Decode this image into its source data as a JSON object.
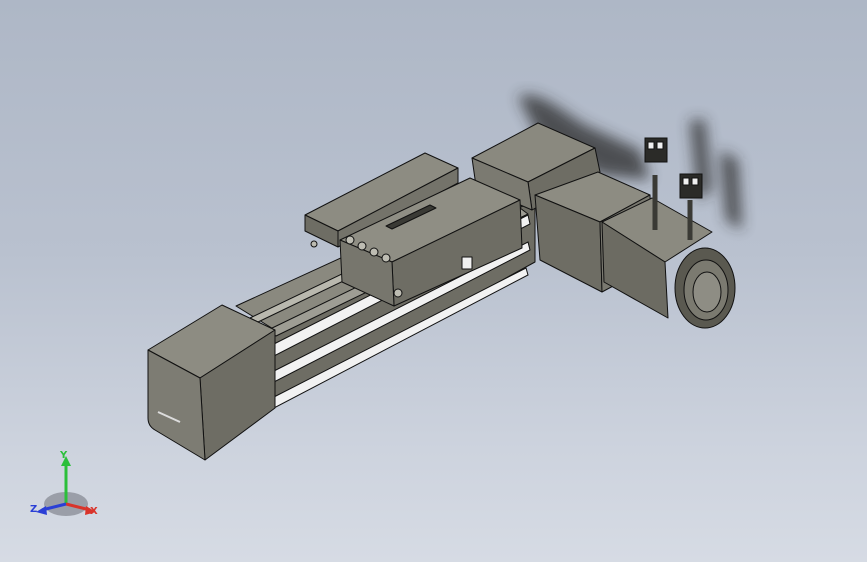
{
  "viewport": {
    "background_top": "#aeb7c6",
    "background_bottom": "#d6dbe4"
  },
  "model": {
    "name_icon": "linear-actuator-model",
    "body_color": "#6b6a61",
    "edge_color": "#111111",
    "slot_color": "#f2f2f2",
    "shadow_color": "#2a2a2a"
  },
  "triad": {
    "x_label": "X",
    "y_label": "Y",
    "z_label": "Z",
    "x_color": "#d9342b",
    "y_color": "#2bbf3a",
    "z_color": "#2a3fd6"
  }
}
